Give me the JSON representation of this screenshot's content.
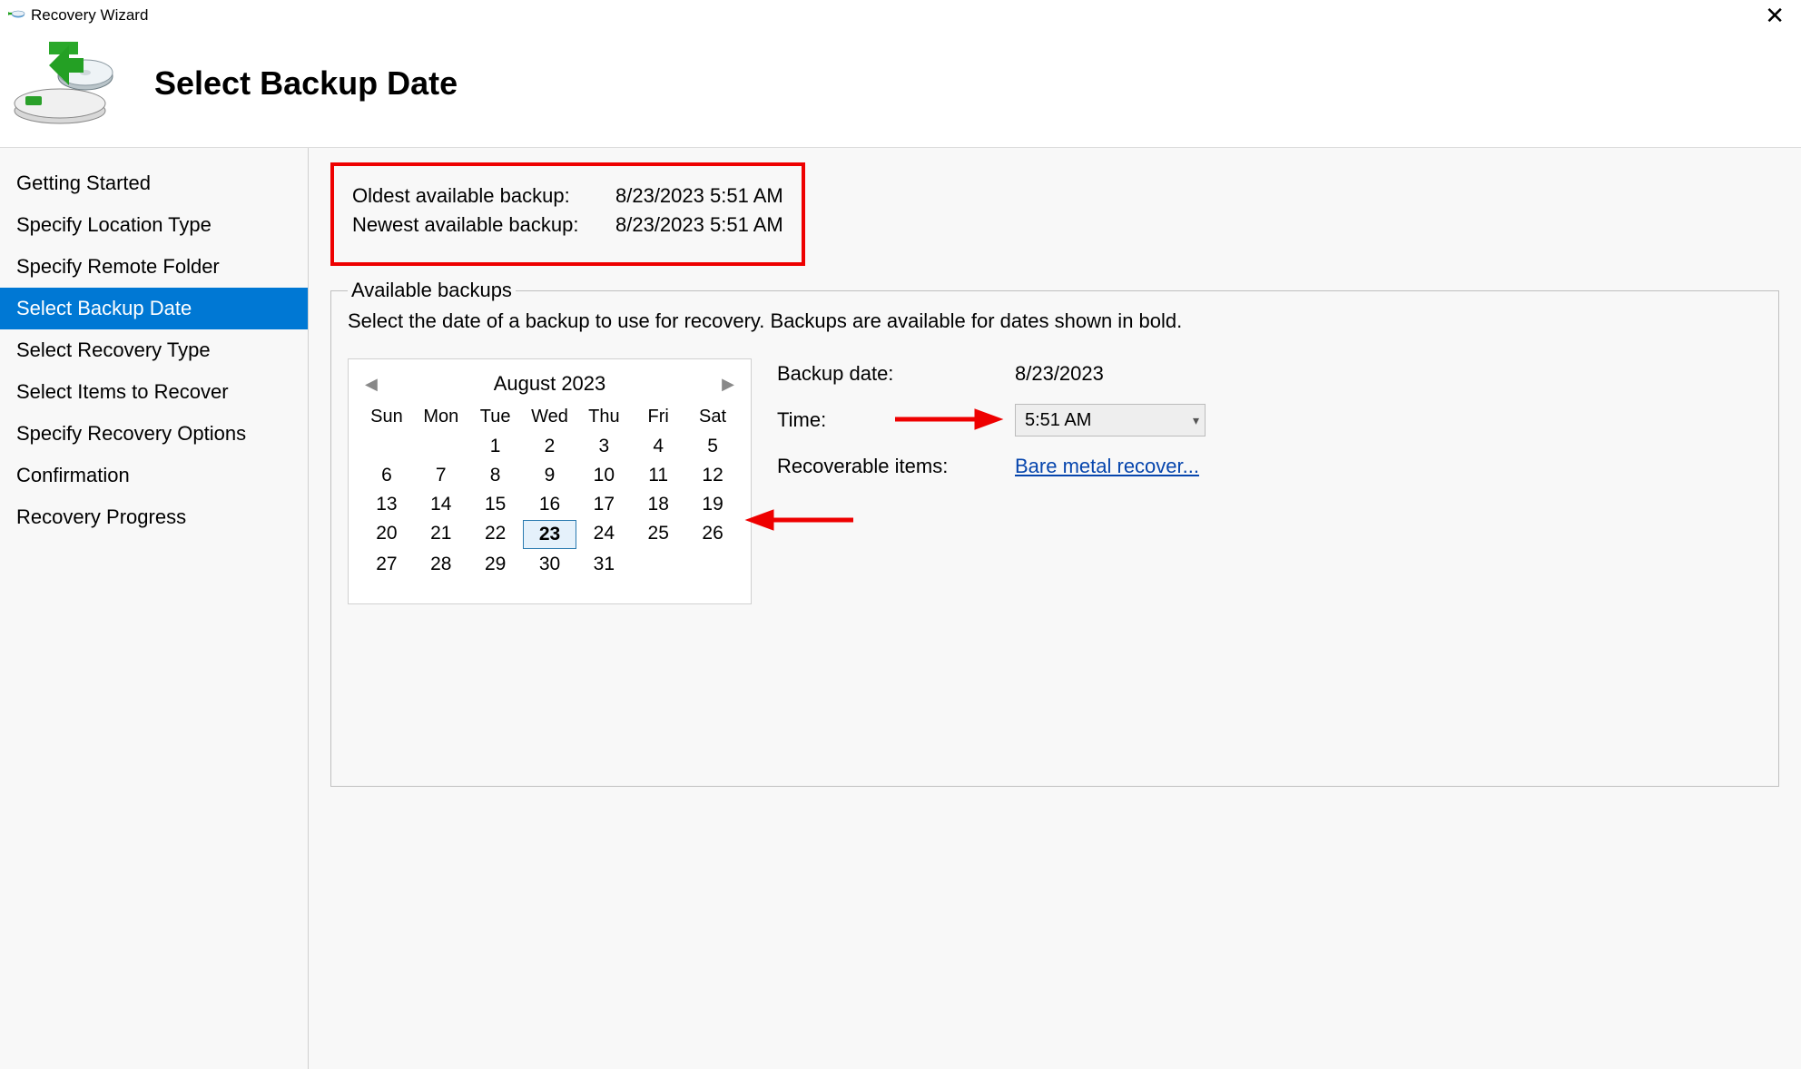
{
  "title": "Recovery Wizard",
  "close_glyph": "✕",
  "header": {
    "title": "Select Backup Date"
  },
  "sidebar": {
    "items": [
      {
        "label": "Getting Started",
        "selected": false
      },
      {
        "label": "Specify Location Type",
        "selected": false
      },
      {
        "label": "Specify Remote Folder",
        "selected": false
      },
      {
        "label": "Select Backup Date",
        "selected": true
      },
      {
        "label": "Select Recovery Type",
        "selected": false
      },
      {
        "label": "Select Items to Recover",
        "selected": false
      },
      {
        "label": "Specify Recovery Options",
        "selected": false
      },
      {
        "label": "Confirmation",
        "selected": false
      },
      {
        "label": "Recovery Progress",
        "selected": false
      }
    ]
  },
  "summary": {
    "oldest_label": "Oldest available backup:",
    "oldest_value": "8/23/2023 5:51 AM",
    "newest_label": "Newest available backup:",
    "newest_value": "8/23/2023 5:51 AM"
  },
  "available": {
    "legend": "Available backups",
    "instructions": "Select the date of a backup to use for recovery. Backups are available for dates shown in bold."
  },
  "calendar": {
    "prev_glyph": "◀",
    "next_glyph": "▶",
    "month_label": "August 2023",
    "dow": [
      "Sun",
      "Mon",
      "Tue",
      "Wed",
      "Thu",
      "Fri",
      "Sat"
    ],
    "leading_blanks": 2,
    "days": 31,
    "selected_day": 23,
    "bold_days": [
      23
    ]
  },
  "details": {
    "backup_date_label": "Backup date:",
    "backup_date_value": "8/23/2023",
    "time_label": "Time:",
    "time_value": "5:51 AM",
    "recoverable_label": "Recoverable items:",
    "recoverable_link": "Bare metal recover..."
  }
}
